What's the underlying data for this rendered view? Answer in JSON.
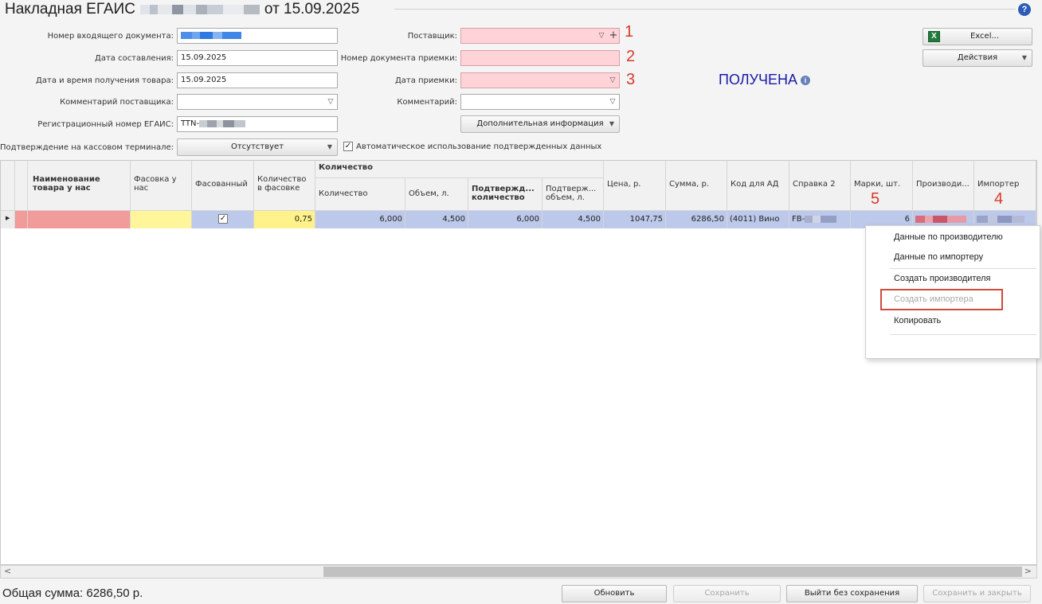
{
  "title": {
    "prefix": "Накладная ЕГАИС",
    "suffix": "от 15.09.2025"
  },
  "form": {
    "incoming_doc_label": "Номер входящего документа:",
    "date_composed_label": "Дата составления:",
    "date_composed_value": "15.09.2025",
    "received_datetime_label": "Дата и время получения товара:",
    "received_datetime_value": "15.09.2025",
    "supplier_comment_label": "Комментарий поставщика:",
    "egais_reg_label": "Регистрационный номер ЕГАИС:",
    "egais_reg_prefix": "TTN-",
    "supplier_label": "Поставщик:",
    "acceptance_doc_label": "Номер документа приемки:",
    "acceptance_date_label": "Дата приемки:",
    "comment_label": "Комментарий:",
    "extra_info_label": "Дополнительная информация",
    "cashier_confirm_label": "Подтверждение на кассовом терминале:",
    "cashier_confirm_value": "Отсутствует",
    "auto_use_label": "Автоматическое использование подтвержденных данных"
  },
  "annotations": {
    "n1": "1",
    "n2": "2",
    "n3": "3",
    "n4": "4",
    "n5": "5"
  },
  "status": {
    "text": "ПОЛУЧЕНА"
  },
  "buttons": {
    "excel": "Excel...",
    "actions": "Действия",
    "refresh": "Обновить",
    "save": "Сохранить",
    "exit_no_save": "Выйти без сохранения",
    "save_close": "Сохранить и закрыть"
  },
  "grid": {
    "headers": {
      "name": "Наименование товара у нас",
      "pack": "Фасовка у нас",
      "packed": "Фасованный",
      "qty_in_pack": "Количество в фасовке",
      "qty_group": "Количество",
      "qty": "Количество",
      "volume": "Объем, л.",
      "confirmed_qty": "Подтвержд... количество",
      "confirmed_vol": "Подтверж... объем, л.",
      "price": "Цена, р.",
      "sum": "Сумма, р.",
      "ad_code": "Код для АД",
      "ref2": "Справка 2",
      "marks": "Марки, шт.",
      "producer": "Производи...",
      "importer": "Импортер"
    },
    "row": {
      "qty_in_pack": "0,75",
      "qty": "6,000",
      "volume": "4,500",
      "confirmed_qty": "6,000",
      "confirmed_vol": "4,500",
      "price": "1047,75",
      "sum": "6286,50",
      "ad_code": "(4011) Вино",
      "ref2_prefix": "FB-",
      "marks": "6"
    }
  },
  "context_menu": {
    "items": [
      "Данные по производителю",
      "Данные по импортеру",
      "Создать производителя",
      "Создать импортера",
      "Копировать"
    ]
  },
  "footer": {
    "total": "Общая сумма: 6286,50 р."
  }
}
